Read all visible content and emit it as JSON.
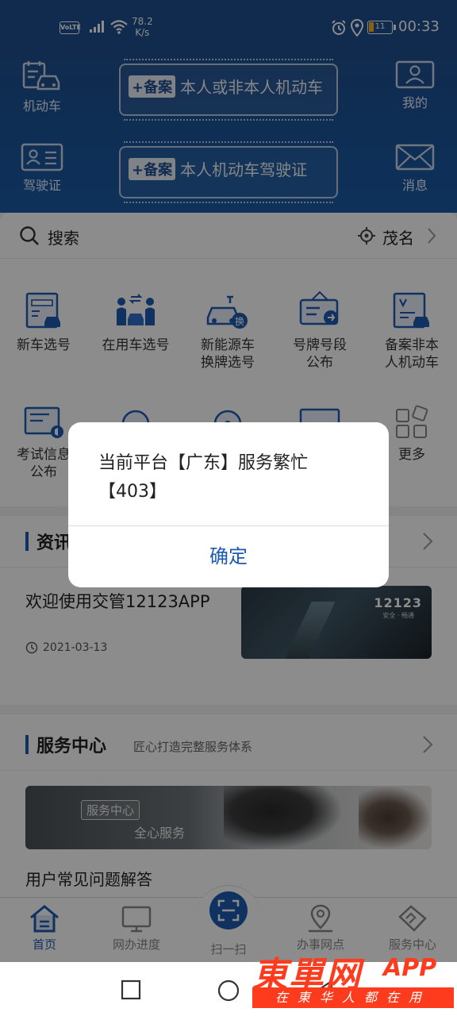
{
  "status_bar": {
    "volte": "VoLTE",
    "speed_value": "78.2",
    "speed_unit": "K/s",
    "battery": "11",
    "time": "00:33"
  },
  "header": {
    "vehicle_label": "机动车",
    "license_label": "驾驶证",
    "mine_label": "我的",
    "message_label": "消息",
    "plate1": {
      "tag": "+备案",
      "text": "本人或非本人机动车"
    },
    "plate2": {
      "tag": "+备案",
      "text": "本人机动车驾驶证"
    }
  },
  "search": {
    "placeholder": "搜索",
    "location": "茂名"
  },
  "services": [
    {
      "line1": "新车选号",
      "line2": ""
    },
    {
      "line1": "在用车选号",
      "line2": ""
    },
    {
      "line1": "新能源车",
      "line2": "换牌选号"
    },
    {
      "line1": "号牌号段",
      "line2": "公布"
    },
    {
      "line1": "备案非本",
      "line2": "人机动车"
    },
    {
      "line1": "考试信息",
      "line2": "公布"
    },
    {
      "line1": "",
      "line2": ""
    },
    {
      "line1": "",
      "line2": ""
    },
    {
      "line1": "",
      "line2": ""
    },
    {
      "line1": "更多",
      "line2": ""
    }
  ],
  "news_section": {
    "title": "资讯",
    "item_title": "欢迎使用交管12123APP",
    "item_date": "2021-03-13",
    "image_logo": "12123",
    "image_logo_sub": "安全 · 畅通"
  },
  "service_center": {
    "title": "服务中心",
    "subtitle": "匠心打造完整服务体系",
    "banner_badge": "服务中心",
    "banner_slogan": "全心服务",
    "faq": "用户常见问题解答"
  },
  "bottom_nav": {
    "home": "首页",
    "progress": "网办进度",
    "scan": "扫一扫",
    "outlets": "办事网点",
    "service": "服务中心"
  },
  "dialog": {
    "message_line1": "当前平台【广东】服务繁忙",
    "message_line2": "【403】",
    "ok": "确定"
  },
  "watermark": {
    "main": "東單网",
    "app": "APP",
    "sub": "在東华人都在用"
  },
  "colors": {
    "header_blue": "#1e4f8f",
    "accent_blue": "#1e5bb0",
    "watermark_red": "#ff3b1e",
    "battery_orange": "#ffb020"
  }
}
